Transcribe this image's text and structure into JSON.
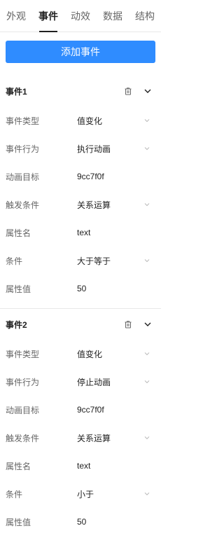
{
  "tabs": [
    "外观",
    "事件",
    "动效",
    "数据",
    "结构"
  ],
  "active_tab": 1,
  "add_button_label": "添加事件",
  "icons": {
    "delete": "trash-icon",
    "collapse": "chevron-down-icon",
    "select": "chevron-down-icon"
  },
  "colors": {
    "accent": "#2f8cff"
  },
  "events": [
    {
      "title": "事件1",
      "rows": [
        {
          "label": "事件类型",
          "value": "值变化",
          "dropdown": true
        },
        {
          "label": "事件行为",
          "value": "执行动画",
          "dropdown": true
        },
        {
          "label": "动画目标",
          "value": "9cc7f0f",
          "dropdown": false
        },
        {
          "label": "触发条件",
          "value": "关系运算",
          "dropdown": true
        },
        {
          "label": "属性名",
          "value": "text",
          "dropdown": false
        },
        {
          "label": "条件",
          "value": "大于等于",
          "dropdown": true
        },
        {
          "label": "属性值",
          "value": "50",
          "dropdown": false
        }
      ]
    },
    {
      "title": "事件2",
      "rows": [
        {
          "label": "事件类型",
          "value": "值变化",
          "dropdown": true
        },
        {
          "label": "事件行为",
          "value": "停止动画",
          "dropdown": true
        },
        {
          "label": "动画目标",
          "value": "9cc7f0f",
          "dropdown": false
        },
        {
          "label": "触发条件",
          "value": "关系运算",
          "dropdown": true
        },
        {
          "label": "属性名",
          "value": "text",
          "dropdown": false
        },
        {
          "label": "条件",
          "value": "小于",
          "dropdown": true
        },
        {
          "label": "属性值",
          "value": "50",
          "dropdown": false
        }
      ]
    }
  ]
}
